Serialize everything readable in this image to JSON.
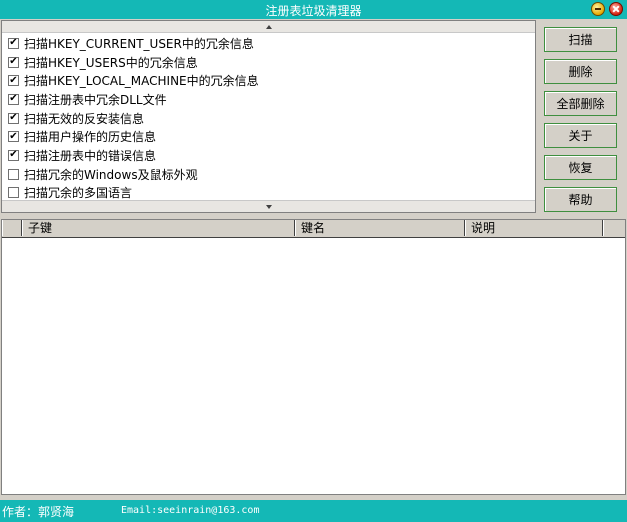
{
  "window": {
    "title": "注册表垃圾清理器"
  },
  "options": [
    {
      "label": "扫描HKEY_CURRENT_USER中的冗余信息",
      "checked": true
    },
    {
      "label": "扫描HKEY_USERS中的冗余信息",
      "checked": true
    },
    {
      "label": "扫描HKEY_LOCAL_MACHINE中的冗余信息",
      "checked": true
    },
    {
      "label": "扫描注册表中冗余DLL文件",
      "checked": true
    },
    {
      "label": "扫描无效的反安装信息",
      "checked": true
    },
    {
      "label": "扫描用户操作的历史信息",
      "checked": true
    },
    {
      "label": "扫描注册表中的错误信息",
      "checked": true
    },
    {
      "label": "扫描冗余的Windows及鼠标外观",
      "checked": false
    },
    {
      "label": "扫描冗余的多国语言",
      "checked": false
    }
  ],
  "buttons": {
    "scan": "扫描",
    "delete": "删除",
    "delete_all": "全部删除",
    "about": "关于",
    "restore": "恢复",
    "help": "帮助"
  },
  "table": {
    "columns": [
      "子键",
      "键名",
      "说明"
    ],
    "rows": []
  },
  "status": {
    "author": "作者：郭贤海",
    "email": "Email:seeinrain@163.com"
  },
  "colors": {
    "titlebar": "#14b8b6",
    "button_border": "#3f8f3f"
  },
  "icons": {
    "minimize": "minimize-icon",
    "close": "close-icon",
    "check": "checkmark-icon"
  }
}
